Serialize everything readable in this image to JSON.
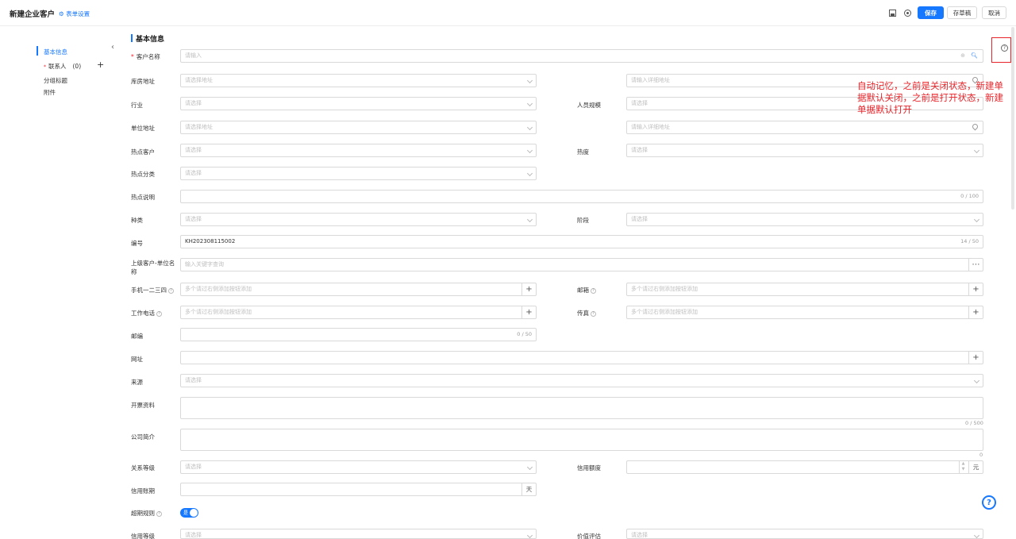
{
  "header": {
    "title": "新建企业客户",
    "form_settings": "表单设置",
    "save": "保存",
    "draft": "存草稿",
    "cancel": "取消"
  },
  "sidebar": {
    "items": [
      {
        "label": "基本信息"
      },
      {
        "label": "联系人",
        "count": "(0)"
      },
      {
        "label": "分组标题"
      },
      {
        "label": "附件"
      }
    ]
  },
  "section": {
    "title": "基本信息"
  },
  "placeholders": {
    "input": "请输入",
    "select": "请选择",
    "select_address": "请选择地址",
    "detail_address": "请输入详细地址",
    "keyword": "输入关键字查询",
    "multi_add": "多个请过右侧添加按钮添加"
  },
  "fields": {
    "customer_name": "客户名称",
    "warehouse_address": "库房地址",
    "industry": "行业",
    "staff_size": "人员规模",
    "company_address": "单位地址",
    "hot_customer": "热点客户",
    "heat": "热度",
    "hot_category": "热点分类",
    "hot_desc": "热点说明",
    "hot_desc_count": "0 / 100",
    "type": "种类",
    "stage": "阶段",
    "code": "编号",
    "code_value": "KH202308115002",
    "code_count": "14 / 50",
    "parent": "上级客户-单位名称",
    "mobile": "手机一二三四",
    "email": "邮箱",
    "work_phone": "工作电话",
    "fax": "传真",
    "postcode": "邮编",
    "postcode_count": "0 / 50",
    "website": "网址",
    "source": "来源",
    "invoice": "开票资料",
    "invoice_count": "0 / 500",
    "intro": "公司简介",
    "intro_count": "0",
    "relation_level": "关系等级",
    "credit_amount": "信用额度",
    "credit_unit": "元",
    "credit_period": "信用账期",
    "period_unit": "天",
    "overdue_rule": "超期规则",
    "toggle_on": "是",
    "credit_level": "信用等级",
    "value_eval": "价值评估"
  },
  "annotation": "自动记忆，之前是关闭状态，新建单据默认关闭，之前是打开状态，新建单据默认打开",
  "colors": {
    "primary": "#1677ff",
    "annotation": "#e8242a"
  }
}
